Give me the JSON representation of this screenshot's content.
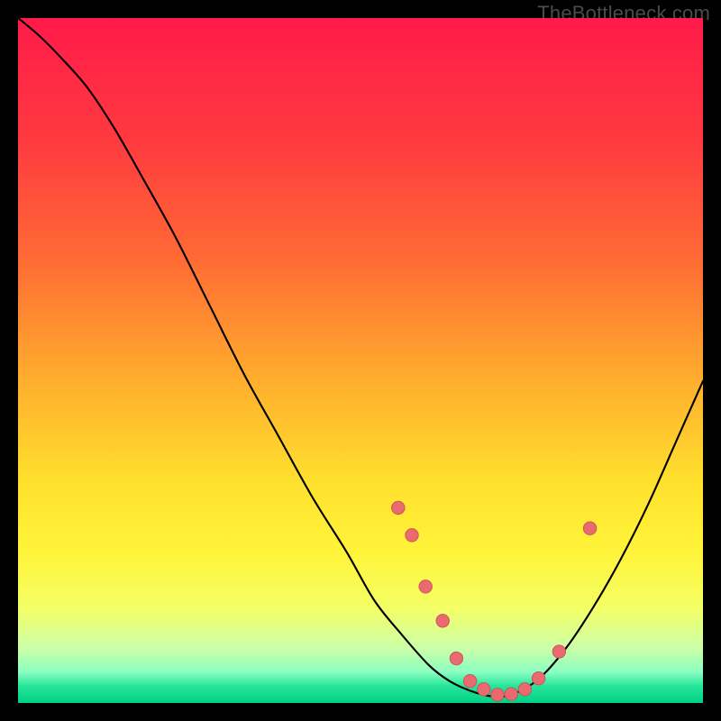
{
  "watermark": "TheBottleneck.com",
  "palette": {
    "bg": "#000000",
    "curve": "#000000",
    "marker_fill": "#e96a6f",
    "marker_stroke": "#c95257"
  },
  "chart_data": {
    "type": "line",
    "title": "",
    "xlabel": "",
    "ylabel": "",
    "xlim": [
      0,
      100
    ],
    "ylim": [
      0,
      100
    ],
    "gradient_stops": [
      {
        "offset": 0.0,
        "color": "#ff1a4a"
      },
      {
        "offset": 0.18,
        "color": "#ff3a3f"
      },
      {
        "offset": 0.35,
        "color": "#ff6a35"
      },
      {
        "offset": 0.53,
        "color": "#ffae2d"
      },
      {
        "offset": 0.68,
        "color": "#ffe12d"
      },
      {
        "offset": 0.78,
        "color": "#fff43a"
      },
      {
        "offset": 0.86,
        "color": "#f4ff64"
      },
      {
        "offset": 0.92,
        "color": "#ccffa8"
      },
      {
        "offset": 0.955,
        "color": "#8affc1"
      },
      {
        "offset": 0.975,
        "color": "#27e59a"
      },
      {
        "offset": 1.0,
        "color": "#00d184"
      }
    ],
    "series": [
      {
        "name": "bottleneck-curve",
        "x": [
          0,
          3,
          6,
          10,
          14,
          18,
          23,
          28,
          33,
          38,
          43,
          48,
          52,
          56,
          60,
          63,
          66,
          69,
          72,
          76,
          80,
          84,
          88,
          92,
          96,
          100
        ],
        "y": [
          100,
          97.5,
          94.5,
          90,
          84,
          77,
          68,
          58,
          48,
          39,
          30,
          22,
          15,
          10,
          5.5,
          3.2,
          1.8,
          1.0,
          1.2,
          3.5,
          8,
          14,
          21,
          29,
          38,
          47
        ]
      }
    ],
    "markers": {
      "name": "highlight-points",
      "x": [
        55.5,
        57.5,
        59.5,
        62,
        64,
        66,
        68,
        70,
        72,
        74,
        76,
        79,
        83.5
      ],
      "y": [
        28.5,
        24.5,
        17,
        12,
        6.5,
        3.2,
        2.0,
        1.2,
        1.3,
        2.0,
        3.6,
        7.5,
        25.5
      ]
    }
  }
}
